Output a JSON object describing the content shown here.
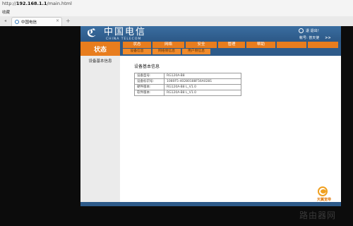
{
  "browser": {
    "url_prefix": "http://",
    "url_host": "192.168.1.1",
    "url_path": "/main.html",
    "menu_label": "收藏",
    "tab_title": "中国电信",
    "tab_close": "×",
    "new_tab": "+",
    "tab_scroll": "◂"
  },
  "header": {
    "logo_mark": "ℭ",
    "logo_cn": "中国电信",
    "logo_en": "CHINA TELECOM",
    "exit_label": "退 退出！",
    "account_label": "帐号: 普天使",
    "account_arrow": ">>"
  },
  "nav": {
    "current": "状态",
    "tabs": [
      {
        "label": "状态"
      },
      {
        "label": "网络"
      },
      {
        "label": "安全"
      },
      {
        "label": "管理"
      },
      {
        "label": "帮助"
      }
    ],
    "subtabs": [
      {
        "label": "设备信息"
      },
      {
        "label": "网络侧信息"
      },
      {
        "label": "用户侧信息"
      }
    ]
  },
  "sidebar": {
    "items": [
      {
        "label": "设备基本信息"
      }
    ]
  },
  "content": {
    "title": "设备基本信息",
    "rows": [
      {
        "key": "设备型号:",
        "value": "RG120A-B8"
      },
      {
        "key": "设备标识号:",
        "value": "1080F5-40280188F56A0281"
      },
      {
        "key": "硬件版本:",
        "value": "RG120A-B8 L_V1.0"
      },
      {
        "key": "软件版本:",
        "value": "RG120A-B8 L_V1.0"
      }
    ]
  },
  "footer": {
    "brand_label": "天翼宽带",
    "watermark": "路由器网"
  },
  "colors": {
    "accent_blue": "#2e5b8a",
    "accent_orange": "#e87d1e"
  }
}
